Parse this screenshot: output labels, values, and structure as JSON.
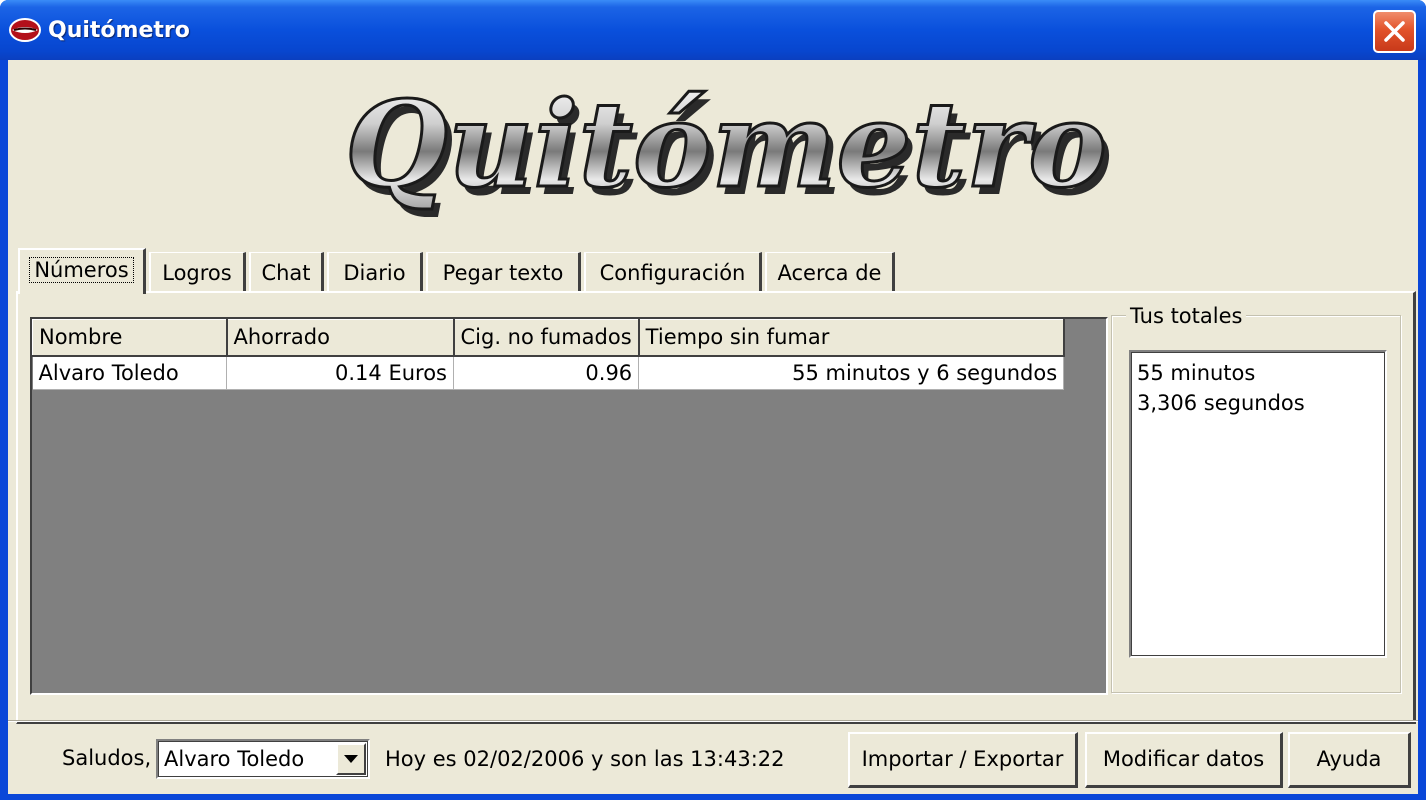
{
  "window": {
    "title": "Quitómetro",
    "logo_text": "Quitómetro"
  },
  "tabs": [
    {
      "label": "Números",
      "active": true
    },
    {
      "label": "Logros",
      "active": false
    },
    {
      "label": "Chat",
      "active": false
    },
    {
      "label": "Diario",
      "active": false
    },
    {
      "label": "Pegar texto",
      "active": false
    },
    {
      "label": "Configuración",
      "active": false
    },
    {
      "label": "Acerca de",
      "active": false
    }
  ],
  "table": {
    "columns": [
      "Nombre",
      "Ahorrado",
      "Cig. no fumados",
      "Tiempo sin fumar"
    ],
    "rows": [
      [
        "Alvaro Toledo",
        "0.14 Euros",
        "0.96",
        "55 minutos y 6 segundos"
      ]
    ]
  },
  "totals": {
    "title": "Tus totales",
    "lines": [
      "55 minutos",
      "3,306 segundos"
    ]
  },
  "footer": {
    "greeting_label": "Saludos,",
    "user_selected": "Alvaro Toledo",
    "status": "Hoy es 02/02/2006 y son las 13:43:22",
    "buttons": {
      "import_export": "Importar / Exportar",
      "modify": "Modificar datos",
      "help": "Ayuda"
    }
  },
  "icons": {
    "app": "lips-icon",
    "close": "close-icon",
    "dropdown": "chevron-down-icon"
  },
  "colors": {
    "titlebar": "#0a50dc",
    "face": "#ece9d8",
    "grid_bg": "#808080",
    "close": "#e2532a"
  }
}
